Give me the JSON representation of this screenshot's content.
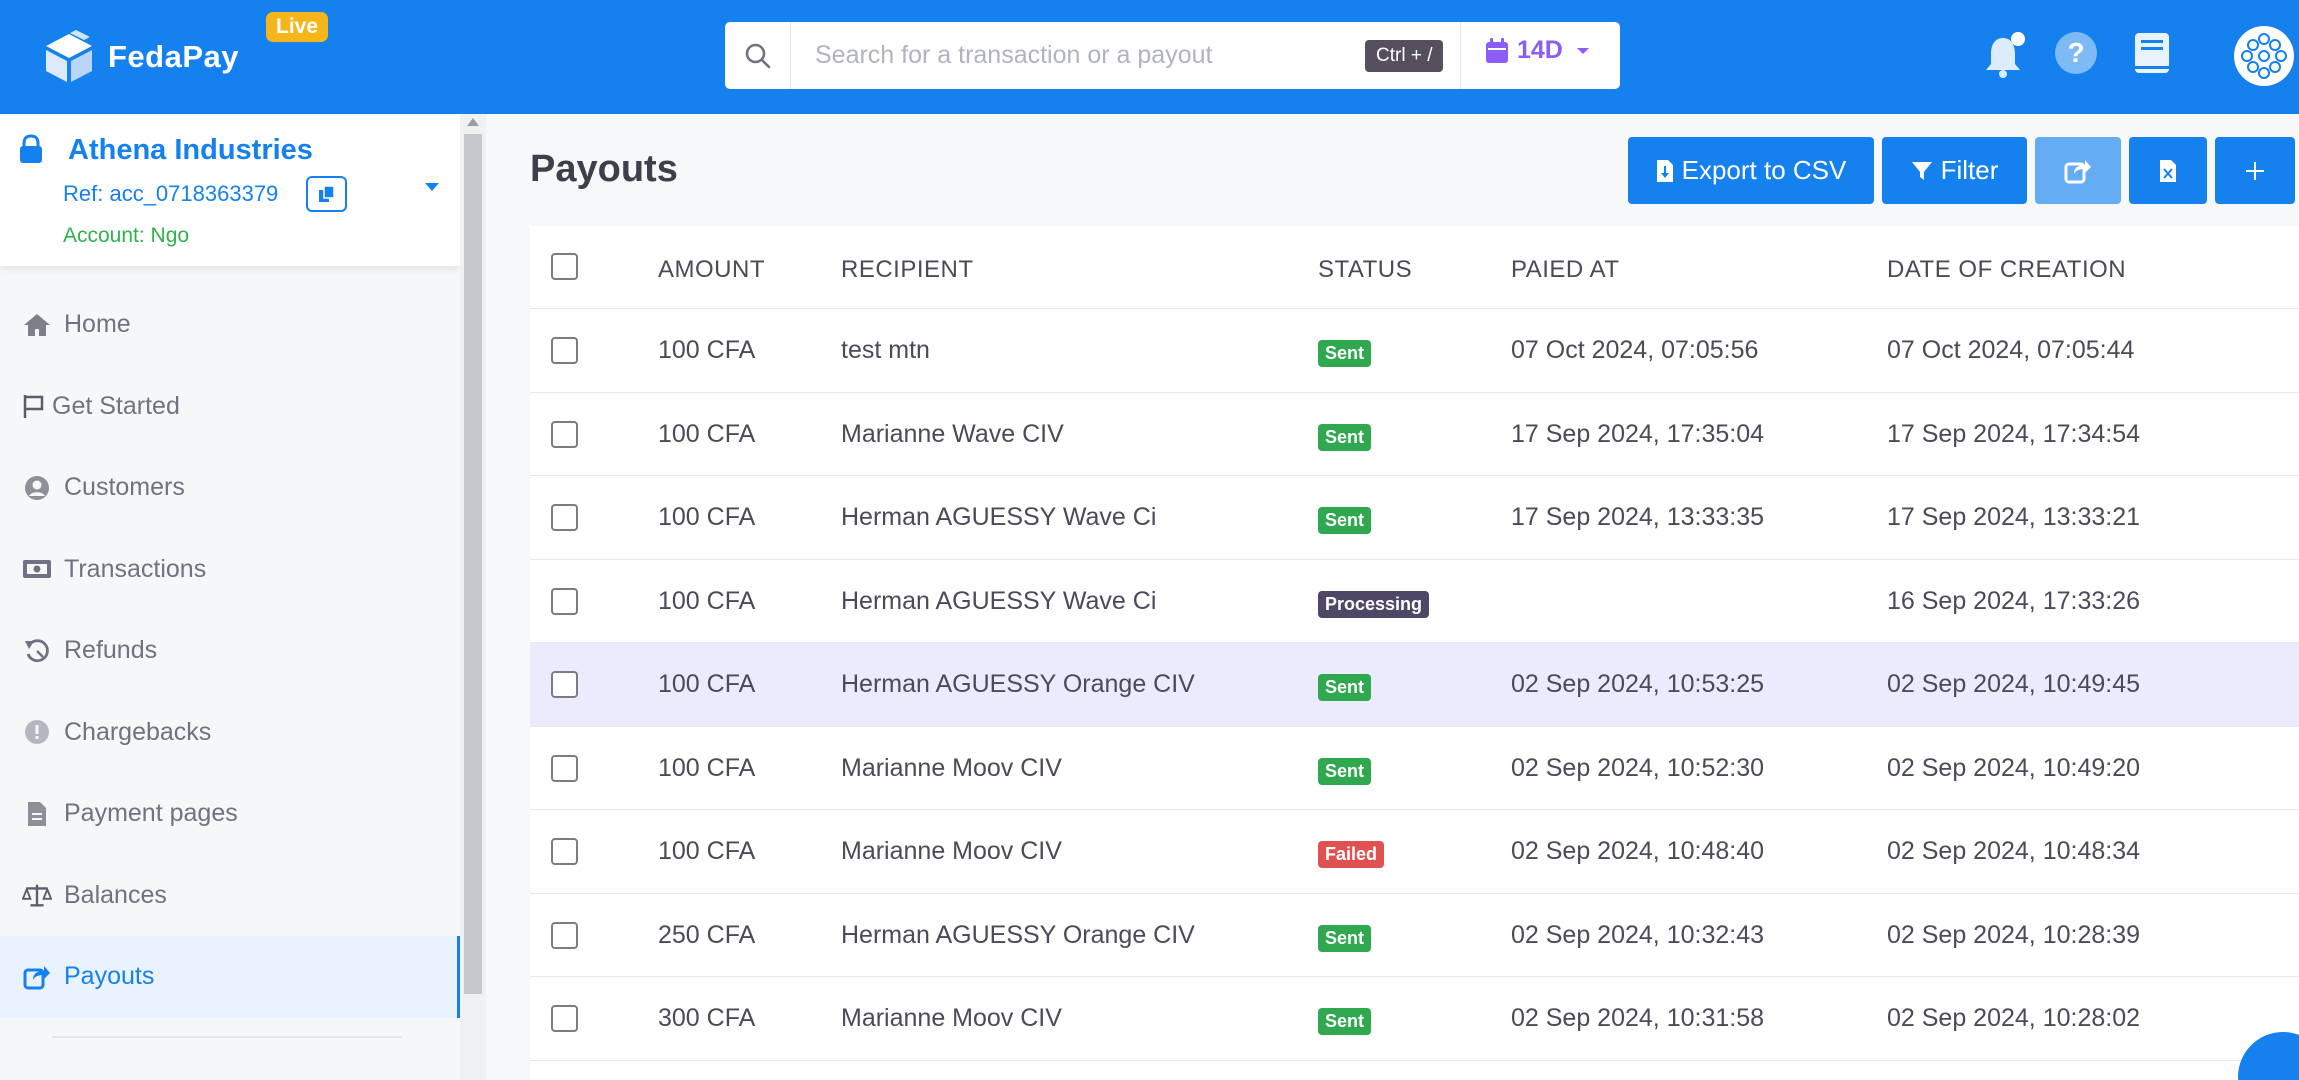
{
  "brand": {
    "name": "FedaPay",
    "mode_badge": "Live"
  },
  "search": {
    "placeholder": "Search for a transaction or a payout",
    "shortcut": "Ctrl + /",
    "date_range": "14D"
  },
  "account": {
    "name": "Athena Industries",
    "ref": "Ref: acc_0718363379",
    "type": "Account: Ngo"
  },
  "nav": {
    "items": [
      {
        "label": "Home",
        "icon": "home-icon"
      },
      {
        "label": "Get Started",
        "icon": "flag-icon"
      },
      {
        "label": "Customers",
        "icon": "user-circle-icon"
      },
      {
        "label": "Transactions",
        "icon": "money-icon"
      },
      {
        "label": "Refunds",
        "icon": "undo-icon"
      },
      {
        "label": "Chargebacks",
        "icon": "exclamation-circle-icon"
      },
      {
        "label": "Payment pages",
        "icon": "document-icon"
      },
      {
        "label": "Balances",
        "icon": "balance-scale-icon"
      },
      {
        "label": "Payouts",
        "icon": "share-icon"
      }
    ],
    "active": "Payouts"
  },
  "page": {
    "title": "Payouts"
  },
  "actions": {
    "export_label": "Export to CSV",
    "filter_label": "Filter"
  },
  "table": {
    "headers": {
      "amount": "AMOUNT",
      "recipient": "RECIPIENT",
      "status": "STATUS",
      "paid_at": "PAIED AT",
      "created": "DATE OF CREATION"
    },
    "rows": [
      {
        "amount": "100 CFA",
        "recipient": "test mtn",
        "status": "Sent",
        "paid_at": "07 Oct 2024, 07:05:56",
        "created": "07 Oct 2024, 07:05:44"
      },
      {
        "amount": "100 CFA",
        "recipient": "Marianne Wave CIV",
        "status": "Sent",
        "paid_at": "17 Sep 2024, 17:35:04",
        "created": "17 Sep 2024, 17:34:54"
      },
      {
        "amount": "100 CFA",
        "recipient": "Herman AGUESSY Wave Ci",
        "status": "Sent",
        "paid_at": "17 Sep 2024, 13:33:35",
        "created": "17 Sep 2024, 13:33:21"
      },
      {
        "amount": "100 CFA",
        "recipient": "Herman AGUESSY Wave Ci",
        "status": "Processing",
        "paid_at": "",
        "created": "16 Sep 2024, 17:33:26"
      },
      {
        "amount": "100 CFA",
        "recipient": "Herman AGUESSY Orange CIV",
        "status": "Sent",
        "paid_at": "02 Sep 2024, 10:53:25",
        "created": "02 Sep 2024, 10:49:45"
      },
      {
        "amount": "100 CFA",
        "recipient": "Marianne Moov CIV",
        "status": "Sent",
        "paid_at": "02 Sep 2024, 10:52:30",
        "created": "02 Sep 2024, 10:49:20"
      },
      {
        "amount": "100 CFA",
        "recipient": "Marianne Moov CIV",
        "status": "Failed",
        "paid_at": "02 Sep 2024, 10:48:40",
        "created": "02 Sep 2024, 10:48:34"
      },
      {
        "amount": "250 CFA",
        "recipient": "Herman AGUESSY Orange CIV",
        "status": "Sent",
        "paid_at": "02 Sep 2024, 10:32:43",
        "created": "02 Sep 2024, 10:28:39"
      },
      {
        "amount": "300 CFA",
        "recipient": "Marianne Moov CIV",
        "status": "Sent",
        "paid_at": "02 Sep 2024, 10:31:58",
        "created": "02 Sep 2024, 10:28:02"
      }
    ]
  },
  "colors": {
    "primary": "#1581ee",
    "live": "#f6b619",
    "sent": "#2fa84f",
    "processing": "#4f4766",
    "failed": "#e05252",
    "date_accent": "#8b5cf6"
  }
}
